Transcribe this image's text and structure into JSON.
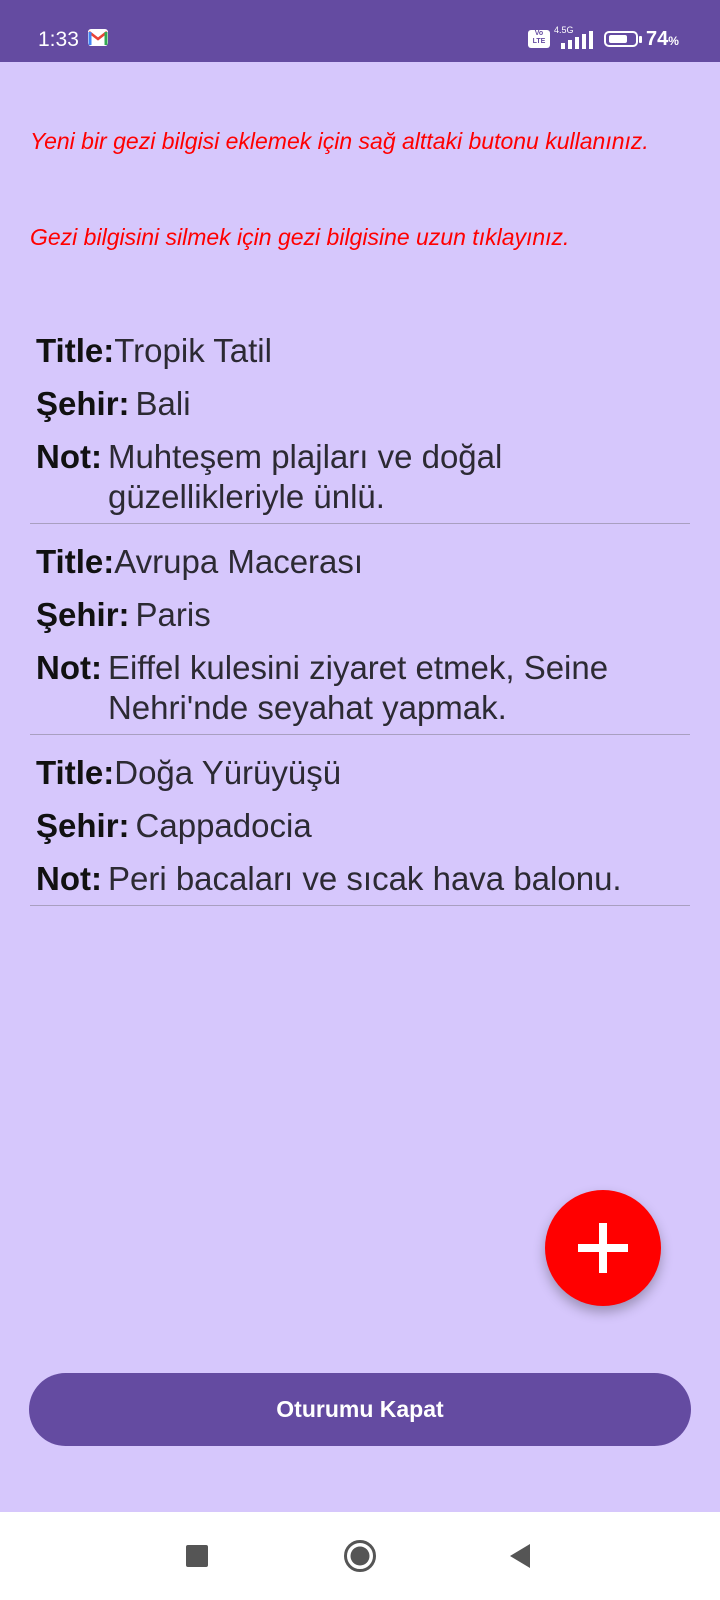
{
  "status_bar": {
    "time": "1:33",
    "network_badge": "Vo LTE",
    "network_type": "4.5G",
    "battery_percent": "74",
    "battery_unit": "%",
    "battery_level": 0.74
  },
  "hints": {
    "add": "Yeni bir gezi bilgisi eklemek için sağ alttaki butonu kullanınız.",
    "delete": "Gezi bilgisini silmek için gezi bilgisine uzun tıklayınız."
  },
  "labels": {
    "title": "Title:",
    "city": "Şehir:",
    "note": "Not:"
  },
  "trips": [
    {
      "title": "Tropik Tatil",
      "city": "Bali",
      "note": "Muhteşem plajları ve doğal güzellikleriyle ünlü."
    },
    {
      "title": "Avrupa Macerası",
      "city": "Paris",
      "note": "Eiffel kulesini ziyaret etmek, Seine Nehri'nde seyahat yapmak."
    },
    {
      "title": "Doğa Yürüyüşü",
      "city": "Cappadocia",
      "note": "Peri bacaları ve sıcak hava balonu."
    }
  ],
  "fab": {
    "icon": "plus-icon",
    "color": "#ff0000"
  },
  "logout": {
    "label": "Oturumu Kapat"
  },
  "colors": {
    "background": "#d6c7fc",
    "primary": "#644ba1",
    "hint": "#ff0000"
  },
  "nav_icons": [
    "recents-square-icon",
    "home-circle-icon",
    "back-triangle-icon"
  ]
}
